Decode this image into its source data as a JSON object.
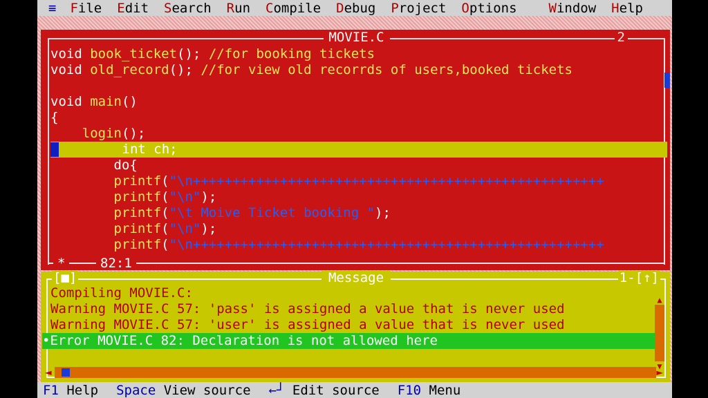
{
  "menu": {
    "system_icon": "≡",
    "items": [
      {
        "hot": "F",
        "rest": "ile"
      },
      {
        "hot": "E",
        "rest": "dit"
      },
      {
        "hot": "S",
        "rest": "earch"
      },
      {
        "hot": "R",
        "rest": "un"
      },
      {
        "hot": "C",
        "rest": "ompile"
      },
      {
        "hot": "D",
        "rest": "ebug"
      },
      {
        "hot": "P",
        "rest": "roject"
      },
      {
        "hot": "O",
        "rest": "ptions"
      },
      {
        "hot": "W",
        "rest": "indow"
      },
      {
        "hot": "H",
        "rest": "elp"
      }
    ]
  },
  "editor": {
    "title": "MOVIE.C",
    "window_number": "2",
    "position": "82:1",
    "modified_marker": "*",
    "lines": [
      [
        {
          "t": "void ",
          "c": "kw"
        },
        {
          "t": "book_ticket",
          "c": "fn"
        },
        {
          "t": "(); ",
          "c": "kw"
        },
        {
          "t": "//for booking tickets",
          "c": "cm"
        }
      ],
      [
        {
          "t": "void ",
          "c": "kw"
        },
        {
          "t": "old_record",
          "c": "fn"
        },
        {
          "t": "(); ",
          "c": "kw"
        },
        {
          "t": "//for view old recorrds of users,booked tickets",
          "c": "cm"
        }
      ],
      [],
      [
        {
          "t": "void ",
          "c": "kw"
        },
        {
          "t": "main",
          "c": "fn"
        },
        {
          "t": "()",
          "c": "kw"
        }
      ],
      [
        {
          "t": "{",
          "c": "kw"
        }
      ],
      [
        {
          "t": "    ",
          "c": "kw"
        },
        {
          "t": "login",
          "c": "fn"
        },
        {
          "t": "();",
          "c": "kw"
        }
      ],
      [
        {
          "t": "         int ch;",
          "c": "kw"
        }
      ],
      [
        {
          "t": "        ",
          "c": "kw"
        },
        {
          "t": "do",
          "c": "kw"
        },
        {
          "t": "{",
          "c": "kw"
        }
      ],
      [
        {
          "t": "        ",
          "c": "kw"
        },
        {
          "t": "printf",
          "c": "fn"
        },
        {
          "t": "(",
          "c": "kw"
        },
        {
          "t": "\"\\n++++++++++++++++++++++++++++++++++++++++++++++++++++",
          "c": "str"
        }
      ],
      [
        {
          "t": "        ",
          "c": "kw"
        },
        {
          "t": "printf",
          "c": "fn"
        },
        {
          "t": "(",
          "c": "kw"
        },
        {
          "t": "\"\\n\"",
          "c": "str"
        },
        {
          "t": ");",
          "c": "kw"
        }
      ],
      [
        {
          "t": "        ",
          "c": "kw"
        },
        {
          "t": "printf",
          "c": "fn"
        },
        {
          "t": "(",
          "c": "kw"
        },
        {
          "t": "\"\\t Moive Ticket booking \"",
          "c": "str"
        },
        {
          "t": ");",
          "c": "kw"
        }
      ],
      [
        {
          "t": "        ",
          "c": "kw"
        },
        {
          "t": "printf",
          "c": "fn"
        },
        {
          "t": "(",
          "c": "kw"
        },
        {
          "t": "\"\\n\"",
          "c": "str"
        },
        {
          "t": ");",
          "c": "kw"
        }
      ],
      [
        {
          "t": "        ",
          "c": "kw"
        },
        {
          "t": "printf",
          "c": "fn"
        },
        {
          "t": "(",
          "c": "kw"
        },
        {
          "t": "\"\\n++++++++++++++++++++++++++++++++++++++++++++++++++++",
          "c": "str"
        }
      ]
    ]
  },
  "message": {
    "title": "Message",
    "close_box": "[■]",
    "window_number": "1-[↑]",
    "lines": [
      "Compiling MOVIE.C:",
      "Warning MOVIE.C 57: 'pass' is assigned a value that is never used",
      "Warning MOVIE.C 57: 'user' is assigned a value that is never used",
      "•Error MOVIE.C 82: Declaration is not allowed here"
    ]
  },
  "statusbar": {
    "items": [
      {
        "key": "F1",
        "label": "Help"
      },
      {
        "key": "Space",
        "label": "View source"
      },
      {
        "key": "←┘",
        "label": "Edit source"
      },
      {
        "key": "F10",
        "label": "Menu"
      }
    ]
  },
  "colors": {
    "editor_bg": "#c81414",
    "message_bg": "#c8c800",
    "selected_error_bg": "#22c422",
    "menu_bg": "#d2d2d2"
  }
}
